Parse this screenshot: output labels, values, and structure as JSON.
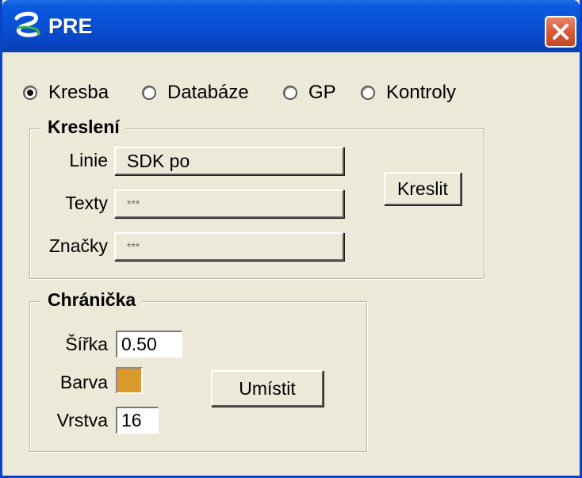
{
  "window": {
    "title": "PRE",
    "icon": "pre-app-icon",
    "close_icon": "close-icon"
  },
  "mode": {
    "options": [
      "Kresba",
      "Databáze",
      "GP",
      "Kontroly"
    ],
    "selected": "Kresba"
  },
  "kresleni": {
    "title": "Kreslení",
    "linie_label": "Linie",
    "linie_value": "SDK po",
    "texty_label": "Texty",
    "texty_value": "***",
    "znacky_label": "Značky",
    "znacky_value": "***",
    "kreslit_label": "Kreslit"
  },
  "chranicka": {
    "title": "Chránička",
    "sirka_label": "Šířka",
    "sirka_value": "0.50",
    "barva_label": "Barva",
    "barva_color": "#d99a2b",
    "vrstva_label": "Vrstva",
    "vrstva_value": "16",
    "umistit_label": "Umístit"
  }
}
